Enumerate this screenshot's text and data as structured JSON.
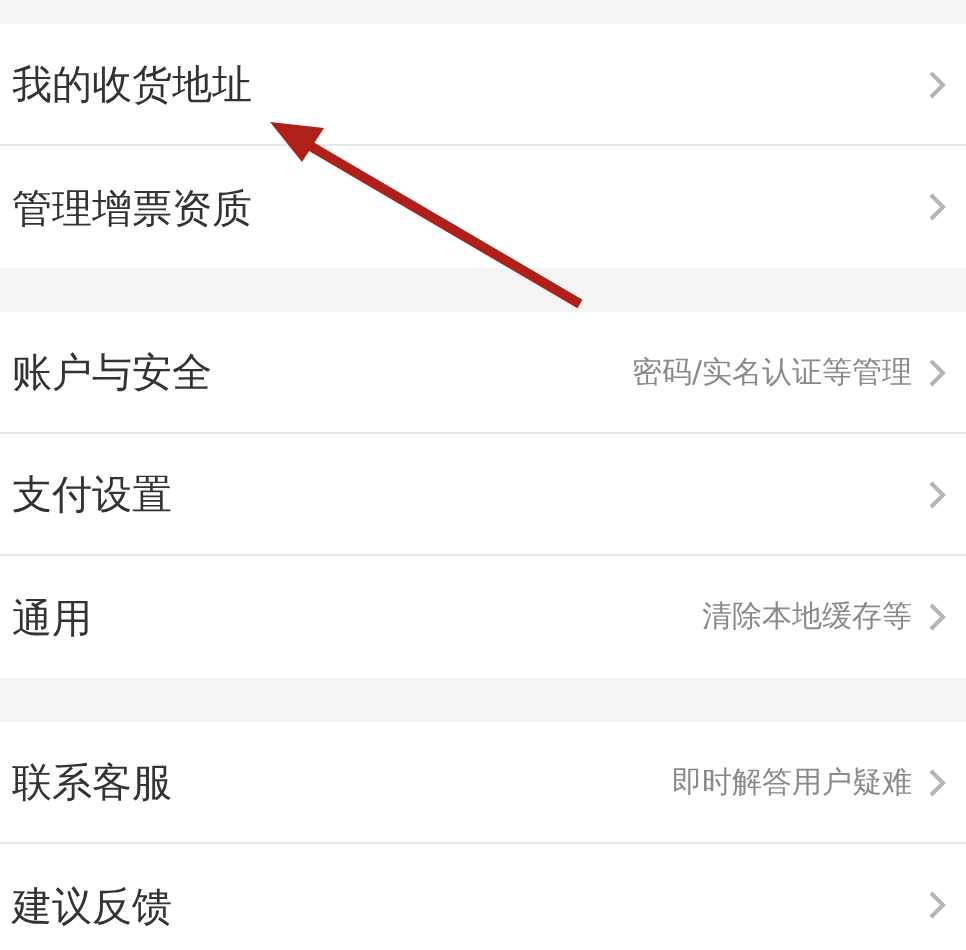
{
  "sections": [
    {
      "items": [
        {
          "label": "我的收货地址"
        },
        {
          "label": "管理增票资质"
        }
      ]
    },
    {
      "items": [
        {
          "label": "账户与安全",
          "hint": "密码/实名认证等管理"
        },
        {
          "label": "支付设置"
        },
        {
          "label": "通用",
          "hint": "清除本地缓存等"
        }
      ]
    },
    {
      "items": [
        {
          "label": "联系客服",
          "hint": "即时解答用户疑难"
        },
        {
          "label": "建议反馈"
        }
      ]
    }
  ]
}
